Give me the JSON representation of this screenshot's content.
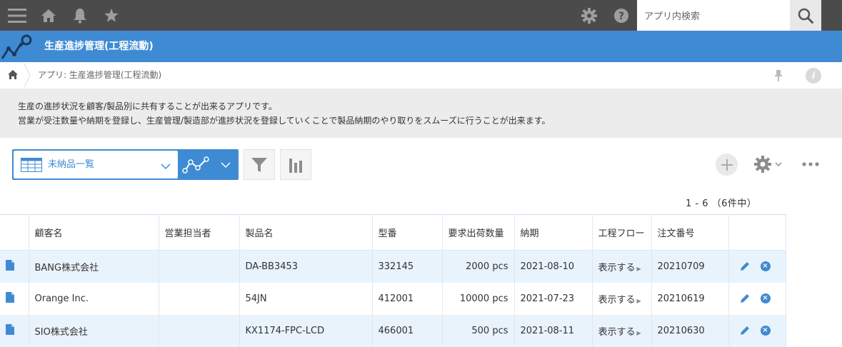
{
  "search": {
    "placeholder": "アプリ内検索"
  },
  "app": {
    "title": "生産進捗管理(工程流動)"
  },
  "breadcrumb": {
    "path": "アプリ: 生産進捗管理(工程流動)"
  },
  "description": {
    "line1": "生産の進捗状況を顧客/製品別に共有することが出来るアプリです。",
    "line2": "営業が受注数量や納期を登録し、生産管理/製造部が進捗状況を登録していくことで製品納期のやり取りをスムーズに行うことが出来ます。"
  },
  "view": {
    "selected": "未納品一覧"
  },
  "count": {
    "text": "1 - 6 （6件中）"
  },
  "colors": {
    "brand": "#3f8bd3",
    "topbar": "#4b4b4b",
    "row_stripe": "#e9f3fc"
  },
  "table": {
    "headers": [
      "",
      "顧客名",
      "営業担当者",
      "製品名",
      "型番",
      "要求出荷数量",
      "納期",
      "工程フロー",
      "注文番号",
      ""
    ],
    "rows": [
      {
        "customer": "BANG株式会社",
        "sales": "",
        "product": "DA-BB3453",
        "model": "332145",
        "qty": "2000 pcs",
        "due": "2021-08-10",
        "flow": "表示する",
        "order": "20210709"
      },
      {
        "customer": "Orange Inc.",
        "sales": "",
        "product": "54JN",
        "model": "412001",
        "qty": "10000 pcs",
        "due": "2021-07-23",
        "flow": "表示する",
        "order": "20210619"
      },
      {
        "customer": "SIO株式会社",
        "sales": "",
        "product": "KX1174-FPC-LCD",
        "model": "466001",
        "qty": "500 pcs",
        "due": "2021-08-11",
        "flow": "表示する",
        "order": "20210630"
      }
    ]
  }
}
